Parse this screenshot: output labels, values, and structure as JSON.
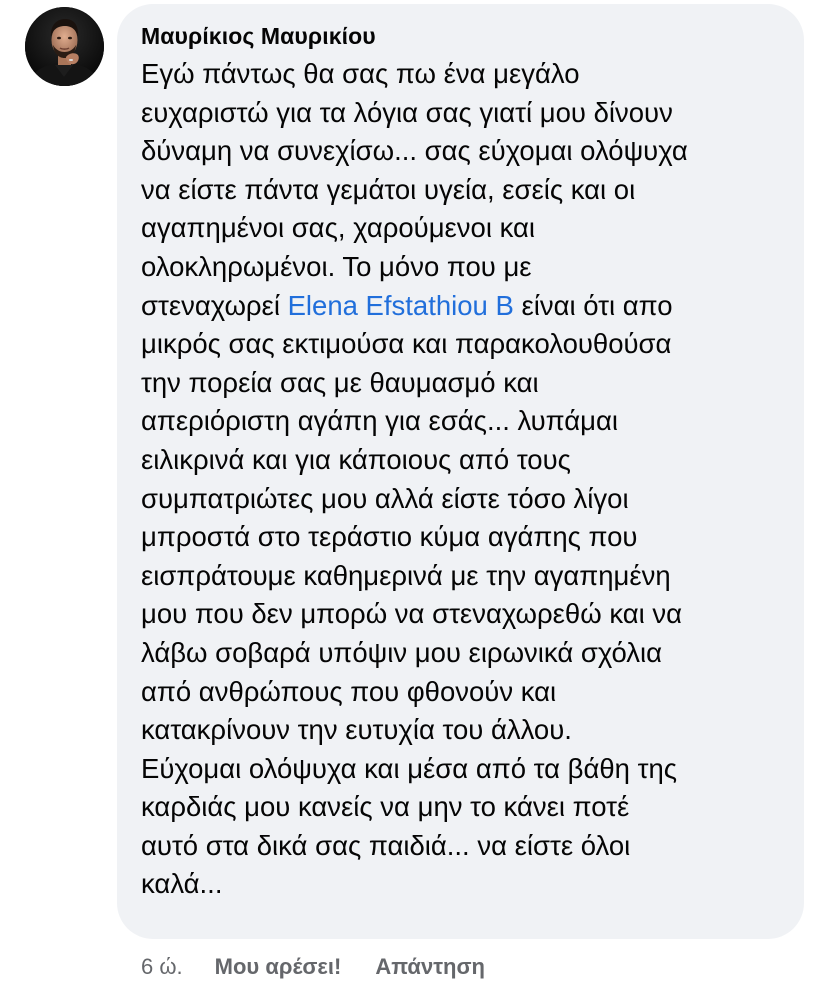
{
  "comment": {
    "author": "Μαυρίκιος Μαυρικίου",
    "text_before_mention": "Εγώ πάντως θα σας πω ένα μεγάλο\nευχαριστώ για τα λόγια σας γιατί μου δίνουν\nδύναμη να συνεχίσω... σας εύχομαι ολόψυχα\nνα είστε πάντα γεμάτοι υγεία, εσείς και οι\nαγαπημένοι σας, χαρούμενοι και\nολοκληρωμένοι. Το μόνο που με\nστεναχωρεί ",
    "mention": "Elena Efstathiou B",
    "text_after_mention": " είναι ότι απο\nμικρός σας εκτιμούσα και παρακολουθούσα\nτην πορεία σας με θαυμασμό και\nαπεριόριστη αγάπη για εσάς... λυπάμαι\nειλικρινά και για κάποιους από τους\nσυμπατριώτες μου αλλά είστε τόσο λίγοι\nμπροστά στο τεράστιο κύμα αγάπης που\nεισπράτουμε καθημερινά με την αγαπημένη\nμου που δεν μπορώ να στεναχωρεθώ και να\nλάβω σοβαρά υπόψιν μου ειρωνικά σχόλια\nαπό ανθρώπους που φθονούν και\nκατακρίνουν την ευτυχία του άλλου.\nΕύχομαι ολόψυχα και μέσα από τα βάθη της\nκαρδιάς μου κανείς να μην το κάνει ποτέ\nαυτό στα δικά σας παιδιά... να είστε όλοι\nκαλά...",
    "mention_color": "#216fdb",
    "bubble_color": "#f0f2f5"
  },
  "actions": {
    "time": "6 ώ.",
    "like_label": "Μου αρέσει!",
    "reply_label": "Απάντηση"
  },
  "icons": {
    "avatar": "profile-photo"
  }
}
